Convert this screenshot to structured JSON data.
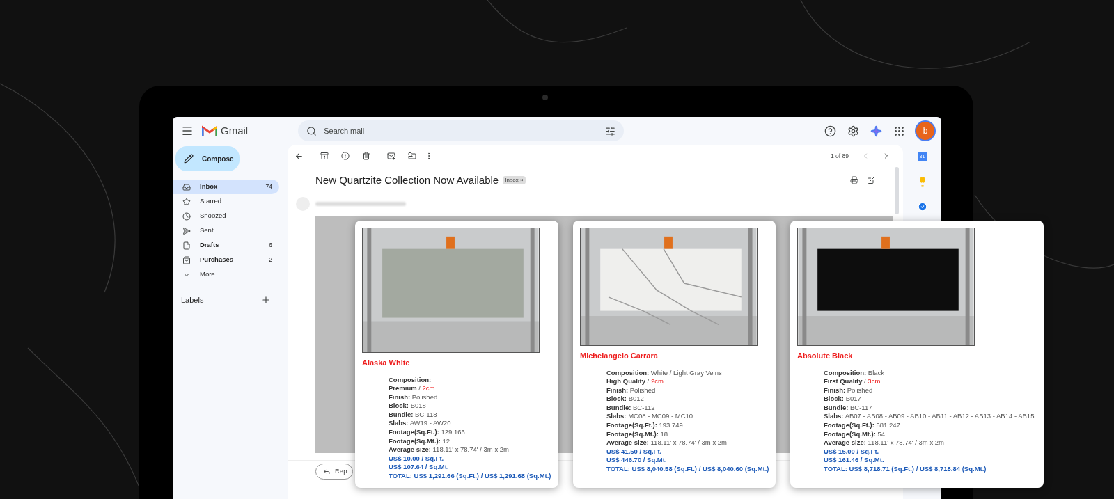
{
  "app": {
    "name": "Gmail"
  },
  "search": {
    "placeholder": "Search mail"
  },
  "account": {
    "initial": "b"
  },
  "compose": {
    "label": "Compose"
  },
  "folders": [
    {
      "kind": "inbox",
      "label": "Inbox",
      "count": "74",
      "selected": true,
      "unread": true
    },
    {
      "kind": "star",
      "label": "Starred",
      "selected": false,
      "unread": false
    },
    {
      "kind": "clock",
      "label": "Snoozed",
      "selected": false,
      "unread": false
    },
    {
      "kind": "send",
      "label": "Sent",
      "selected": false,
      "unread": false
    },
    {
      "kind": "file",
      "label": "Drafts",
      "count": "6",
      "selected": false,
      "unread": true
    },
    {
      "kind": "bag",
      "label": "Purchases",
      "count": "2",
      "selected": false,
      "unread": true
    },
    {
      "kind": "more",
      "label": "More",
      "selected": false,
      "unread": false
    }
  ],
  "labels": {
    "heading": "Labels"
  },
  "message": {
    "pager": "1 of 89",
    "subject": "New Quartzite Collection Now Available",
    "chip": {
      "label": "Inbox",
      "remove": "×"
    },
    "reply": "Rep"
  },
  "rail": {
    "calendar_day": "31"
  },
  "products": [
    {
      "name": "Alaska White",
      "color": "#a3a9a0",
      "details": [
        {
          "kind": "field",
          "label": "Composition:"
        },
        {
          "kind": "grade",
          "label": "Premium",
          "value": "/",
          "accent": "2cm"
        },
        {
          "kind": "field",
          "label": "Finish:",
          "value": "Polished"
        },
        {
          "kind": "field",
          "label": "Block:",
          "value": "B018"
        },
        {
          "kind": "field",
          "label": "Bundle:",
          "value": "BC-118"
        },
        {
          "kind": "field",
          "label": "Slabs:",
          "value": "AW19 - AW20"
        },
        {
          "kind": "field",
          "label": "Footage(Sq.Ft.):",
          "value": "129.166"
        },
        {
          "kind": "field",
          "label": "Footage(Sq.Mt.):",
          "value": "12"
        },
        {
          "kind": "field",
          "label": "Average size:",
          "value": "118.11' x 78.74' / 3m x 2m"
        },
        {
          "kind": "price",
          "text": "US$ 10.00 / Sq.Ft."
        },
        {
          "kind": "price",
          "text": "US$ 107.64 / Sq.Mt."
        },
        {
          "kind": "price",
          "text": "TOTAL: US$ 1,291.66 (Sq.Ft.) / US$ 1,291.68 (Sq.Mt.)"
        }
      ]
    },
    {
      "name": "Michelangelo Carrara",
      "color": "#efefed",
      "details": [
        {
          "kind": "field",
          "label": "Composition:",
          "value": "White / Light Gray Veins"
        },
        {
          "kind": "grade",
          "label": "High Quality",
          "value": "/",
          "accent": "2cm"
        },
        {
          "kind": "field",
          "label": "Finish:",
          "value": "Polished"
        },
        {
          "kind": "field",
          "label": "Block:",
          "value": "B012"
        },
        {
          "kind": "field",
          "label": "Bundle:",
          "value": "BC-112"
        },
        {
          "kind": "field",
          "label": "Slabs:",
          "value": "MC08 - MC09 - MC10"
        },
        {
          "kind": "field",
          "label": "Footage(Sq.Ft.):",
          "value": "193.749"
        },
        {
          "kind": "field",
          "label": "Footage(Sq.Mt.):",
          "value": "18"
        },
        {
          "kind": "field",
          "label": "Average size:",
          "value": "118.11' x 78.74' / 3m x 2m"
        },
        {
          "kind": "price",
          "text": "US$ 41.50 / Sq.Ft."
        },
        {
          "kind": "price",
          "text": "US$ 446.70 / Sq.Mt."
        },
        {
          "kind": "price",
          "text": "TOTAL: US$ 8,040.58 (Sq.Ft.) / US$ 8,040.60 (Sq.Mt.)"
        }
      ]
    },
    {
      "name": "Absolute Black",
      "color": "#0d0d0d",
      "details": [
        {
          "kind": "field",
          "label": "Composition:",
          "value": "Black"
        },
        {
          "kind": "grade",
          "label": "First Quality",
          "value": "/",
          "accent": "3cm"
        },
        {
          "kind": "field",
          "label": "Finish:",
          "value": "Polished"
        },
        {
          "kind": "field",
          "label": "Block:",
          "value": "B017"
        },
        {
          "kind": "field",
          "label": "Bundle:",
          "value": "BC-117"
        },
        {
          "kind": "field",
          "label": "Slabs:",
          "value": "AB07 - AB08 - AB09 - AB10 - AB11 - AB12 - AB13 - AB14 - AB15"
        },
        {
          "kind": "field",
          "label": "Footage(Sq.Ft.):",
          "value": "581.247"
        },
        {
          "kind": "field",
          "label": "Footage(Sq.Mt.):",
          "value": "54"
        },
        {
          "kind": "field",
          "label": "Average size:",
          "value": "118.11' x 78.74' / 3m x 2m"
        },
        {
          "kind": "price",
          "text": "US$ 15.00 / Sq.Ft."
        },
        {
          "kind": "price",
          "text": "US$ 161.46 / Sq.Mt."
        },
        {
          "kind": "price",
          "text": "TOTAL: US$ 8,718.71 (Sq.Ft.) / US$ 8,718.84 (Sq.Mt.)"
        }
      ]
    }
  ]
}
